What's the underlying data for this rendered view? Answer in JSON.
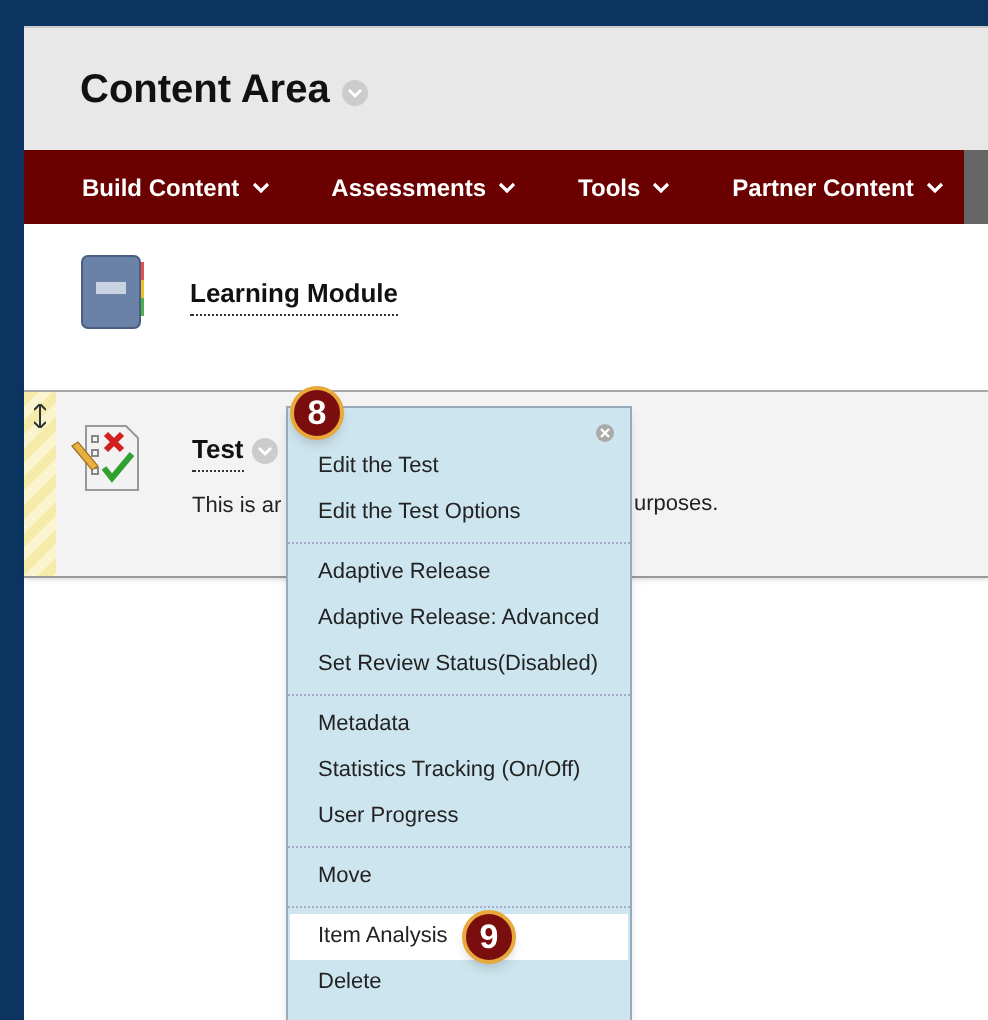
{
  "page_title": "Content Area",
  "nav_items": [
    "Build Content",
    "Assessments",
    "Tools",
    "Partner Content"
  ],
  "items": [
    {
      "kind": "module",
      "title": "Learning Module"
    },
    {
      "kind": "test",
      "title": "Test",
      "description_start": "This is ar",
      "description_end": "urposes.",
      "callout": "8"
    }
  ],
  "context_menu": {
    "groups": [
      [
        {
          "label": "Edit the Test",
          "selected": false
        },
        {
          "label": "Edit the Test Options",
          "selected": false
        }
      ],
      [
        {
          "label": "Adaptive Release",
          "selected": false
        },
        {
          "label": "Adaptive Release: Advanced",
          "selected": false
        },
        {
          "label": "Set Review Status(Disabled)",
          "selected": false
        }
      ],
      [
        {
          "label": "Metadata",
          "selected": false
        },
        {
          "label": "Statistics Tracking (On/Off)",
          "selected": false
        },
        {
          "label": "User Progress",
          "selected": false
        }
      ],
      [
        {
          "label": "Move",
          "selected": false
        }
      ],
      [
        {
          "label": "Item Analysis",
          "selected": true,
          "callout": "9"
        },
        {
          "label": "Delete",
          "selected": false
        }
      ]
    ]
  }
}
